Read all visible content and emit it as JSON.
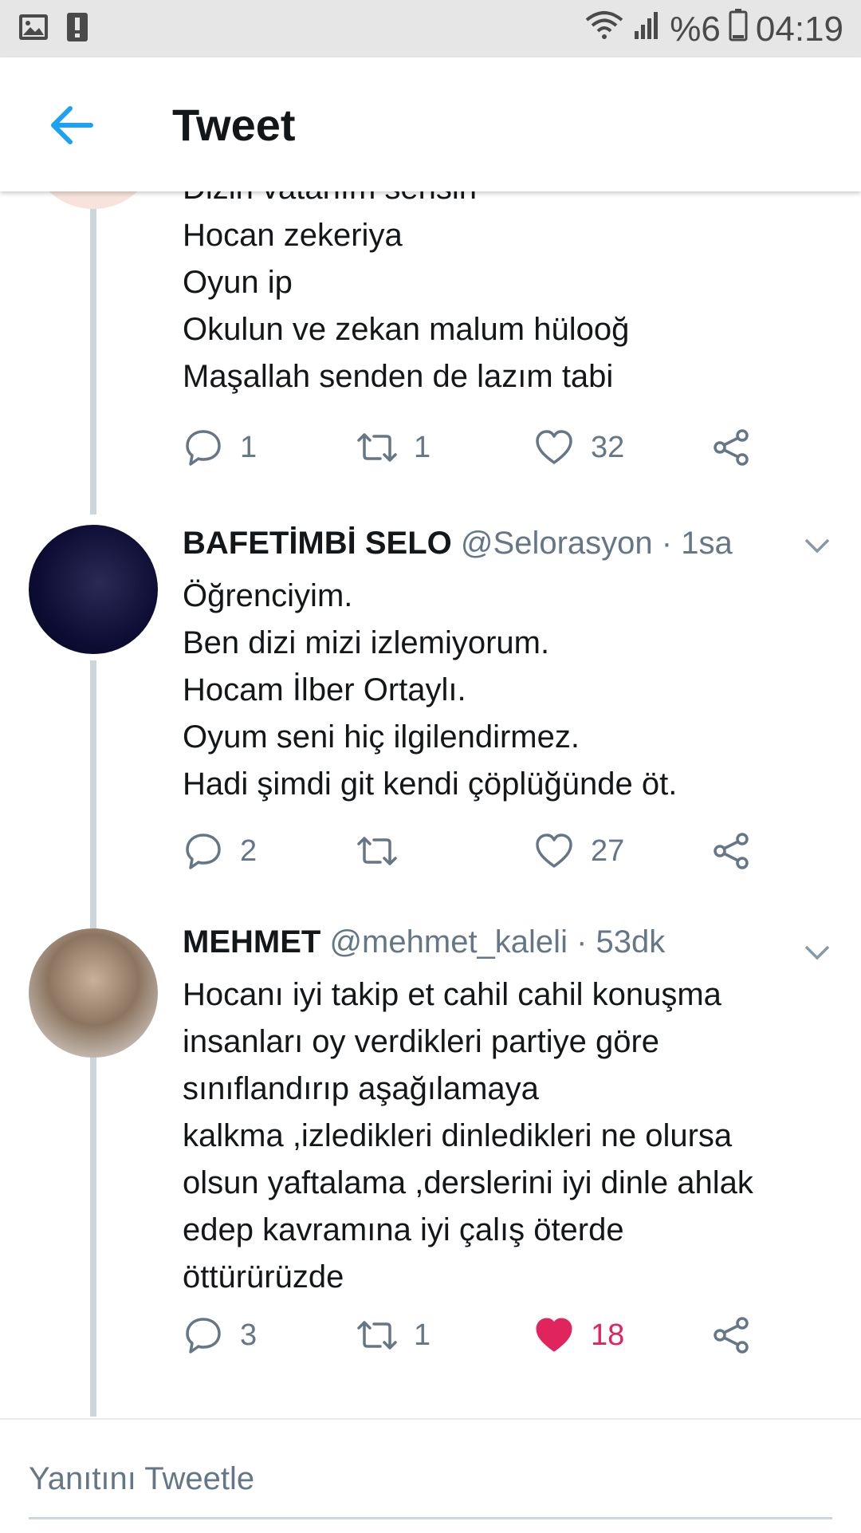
{
  "status_bar": {
    "battery_text": "%6",
    "time": "04:19",
    "icons": [
      "image-icon",
      "alert-icon",
      "wifi-icon",
      "signal-icon",
      "battery-icon"
    ]
  },
  "header": {
    "title": "Tweet",
    "back_icon": "arrow-left-icon",
    "accent": "#1da1f2"
  },
  "tweets": [
    {
      "text": "Dizin vatanım sensin\nHocan zekeriya\nOyun ip\nOkulun ve zekan malum hülooğ\nMaşallah senden de lazım tabi",
      "replies": "1",
      "retweets": "1",
      "likes": "32",
      "liked": false
    },
    {
      "name": "BAFETİMBİ SELO",
      "handle": "@Selorasyon",
      "time": "· 1sa",
      "text": "Öğrenciyim.\nBen dizi mizi izlemiyorum.\nHocam İlber Ortaylı.\nOyum seni hiç ilgilendirmez.\nHadi şimdi git kendi çöplüğünde öt.",
      "replies": "2",
      "retweets": "",
      "likes": "27",
      "liked": false
    },
    {
      "name": "MEHMET",
      "handle": "@mehmet_kaleli",
      "time": "· 53dk",
      "text": "Hocanı iyi takip et cahil cahil konuşma\ninsanları oy verdikleri partiye göre\nsınıflandırıp aşağılamaya\nkalkma ,izledikleri dinledikleri ne olursa\nolsun yaftalama ,derslerini iyi dinle ahlak\nedep kavramına iyi çalış öterde\nöttürürüzde",
      "replies": "3",
      "retweets": "1",
      "likes": "18",
      "liked": true
    }
  ],
  "compose": {
    "placeholder": "Yanıtını Tweetle"
  },
  "colors": {
    "icon_gray": "#657786",
    "like_red": "#e0245e",
    "thread_line": "#ccd6dd"
  }
}
